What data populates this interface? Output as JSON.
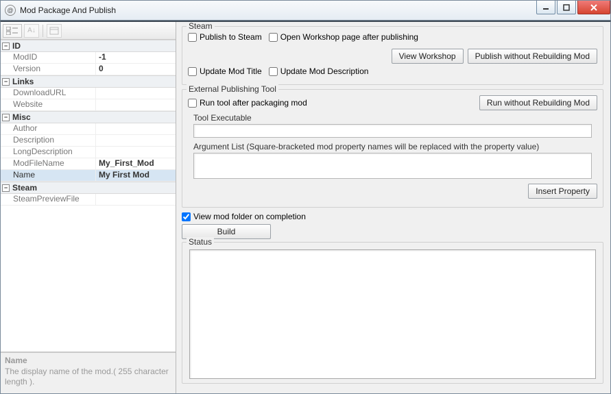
{
  "window": {
    "title": "Mod Package And Publish"
  },
  "propgrid": {
    "categories": [
      {
        "name": "ID",
        "rows": [
          {
            "label": "ModID",
            "value": "-1"
          },
          {
            "label": "Version",
            "value": "0"
          }
        ]
      },
      {
        "name": "Links",
        "rows": [
          {
            "label": "DownloadURL",
            "value": ""
          },
          {
            "label": "Website",
            "value": ""
          }
        ]
      },
      {
        "name": "Misc",
        "rows": [
          {
            "label": "Author",
            "value": ""
          },
          {
            "label": "Description",
            "value": ""
          },
          {
            "label": "LongDescription",
            "value": ""
          },
          {
            "label": "ModFileName",
            "value": "My_First_Mod"
          },
          {
            "label": "Name",
            "value": "My First Mod",
            "selected": true
          }
        ]
      },
      {
        "name": "Steam",
        "rows": [
          {
            "label": "SteamPreviewFile",
            "value": ""
          }
        ]
      }
    ],
    "help": {
      "title": "Name",
      "text": "The display name of the mod.( 255 character length )."
    }
  },
  "steam": {
    "legend": "Steam",
    "publish_to_steam": "Publish to Steam",
    "open_workshop_after": "Open Workshop page after publishing",
    "view_workshop": "View Workshop",
    "publish_without_rebuild": "Publish without Rebuilding Mod",
    "update_title": "Update Mod Title",
    "update_desc": "Update Mod Description"
  },
  "ext": {
    "legend": "External Publishing Tool",
    "run_after": "Run tool after packaging mod",
    "run_without_rebuild": "Run without Rebuilding Mod",
    "tool_exe_label": "Tool Executable",
    "arg_list_label": "Argument List (Square-bracketed mod property names will be replaced with the property value)",
    "insert_property": "Insert Property"
  },
  "footer": {
    "view_on_completion": "View mod folder on completion",
    "view_checked": true,
    "build": "Build",
    "status_legend": "Status"
  }
}
